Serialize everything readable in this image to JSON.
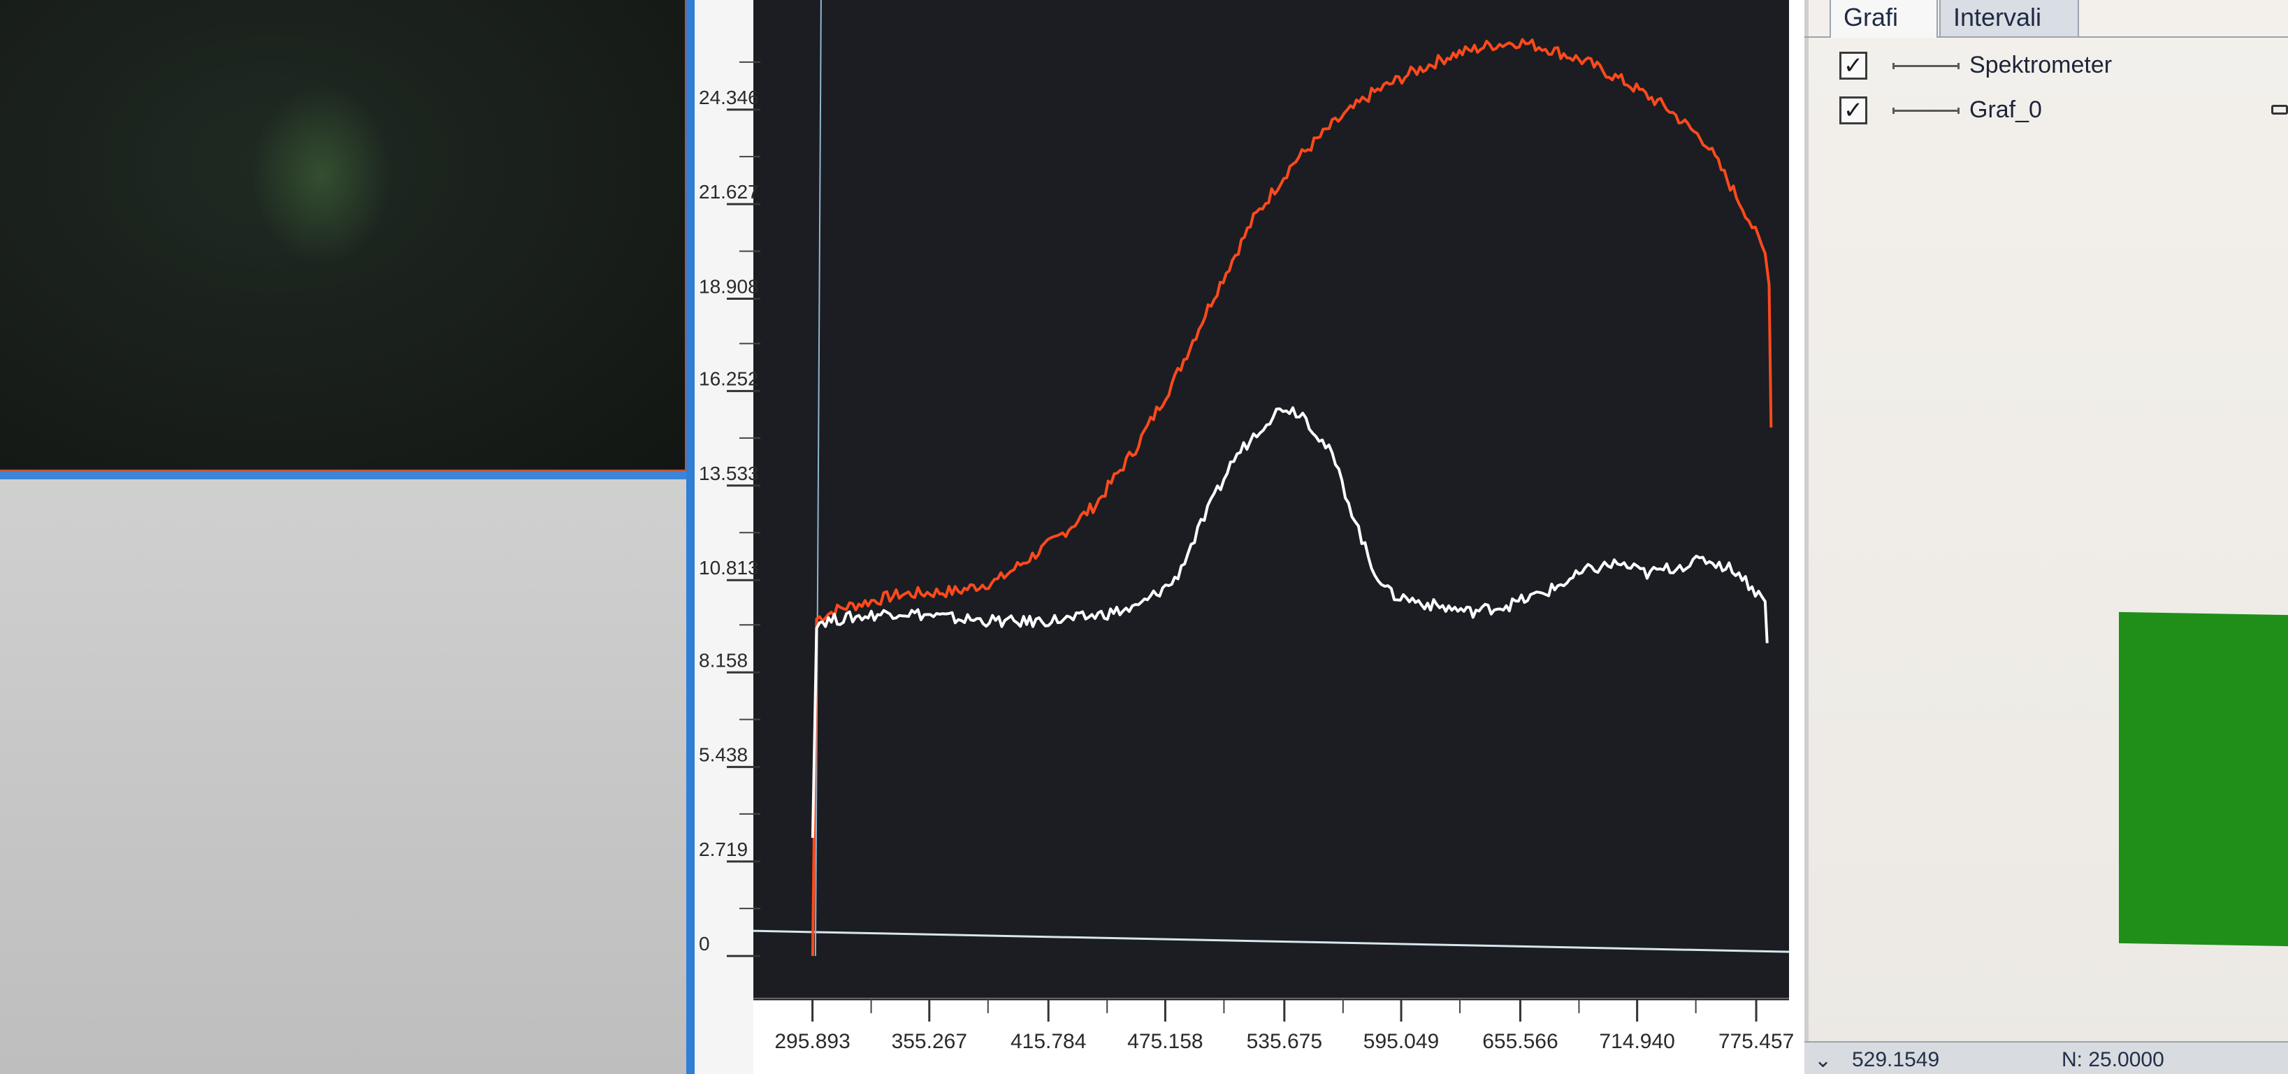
{
  "window": {
    "tabs": [
      {
        "label": "Grafi",
        "active": true
      },
      {
        "label": "Intervali",
        "active": false
      }
    ],
    "legend": [
      {
        "label": "Spektrometer",
        "checked": true,
        "color": "#ff4a1c"
      },
      {
        "label": "Graf_0",
        "checked": true,
        "color": "#ffffff"
      }
    ],
    "status": {
      "left": "529.1549",
      "right": "N: 25.0000"
    }
  },
  "colors": {
    "plot_background": "#1b1d22",
    "baseline": "#d8e6ee",
    "window_accent": "#2f7fd6",
    "swatch": "#1f8f1a"
  },
  "chart_data": {
    "type": "line",
    "title": "",
    "xlabel": "",
    "ylabel": "",
    "x_ticks": [
      "295.893",
      "355.267",
      "415.784",
      "475.158",
      "535.675",
      "595.049",
      "655.566",
      "714.940",
      "775.457"
    ],
    "y_ticks": [
      "0",
      "2.719",
      "5.438",
      "8.158",
      "10.813",
      "13.533",
      "16.252",
      "18.908",
      "21.627",
      "24.346"
    ],
    "xlim": [
      290,
      790
    ],
    "ylim": [
      -0.6,
      27.5
    ],
    "grid": false,
    "series": [
      {
        "name": "Spektrometer",
        "color": "#ff4a1c",
        "points": [
          [
            296,
            0
          ],
          [
            298,
            9.7
          ],
          [
            310,
            10.0
          ],
          [
            340,
            10.4
          ],
          [
            370,
            10.5
          ],
          [
            390,
            10.8
          ],
          [
            400,
            11.2
          ],
          [
            420,
            12.0
          ],
          [
            440,
            13.0
          ],
          [
            460,
            14.6
          ],
          [
            480,
            16.6
          ],
          [
            500,
            19.0
          ],
          [
            520,
            21.2
          ],
          [
            540,
            22.8
          ],
          [
            560,
            23.9
          ],
          [
            580,
            24.8
          ],
          [
            600,
            25.4
          ],
          [
            620,
            25.9
          ],
          [
            640,
            26.2
          ],
          [
            655,
            26.3
          ],
          [
            670,
            26.1
          ],
          [
            690,
            25.7
          ],
          [
            710,
            25.1
          ],
          [
            730,
            24.4
          ],
          [
            750,
            23.4
          ],
          [
            770,
            21.4
          ],
          [
            780,
            20.2
          ],
          [
            782,
            19.3
          ],
          [
            783,
            15.2
          ]
        ]
      },
      {
        "name": "Graf_0",
        "color": "#ffffff",
        "points": [
          [
            296,
            3.4
          ],
          [
            298,
            9.6
          ],
          [
            310,
            9.7
          ],
          [
            340,
            9.9
          ],
          [
            370,
            9.7
          ],
          [
            400,
            9.6
          ],
          [
            430,
            9.7
          ],
          [
            460,
            10.0
          ],
          [
            480,
            10.8
          ],
          [
            495,
            12.6
          ],
          [
            510,
            14.3
          ],
          [
            525,
            15.3
          ],
          [
            535,
            15.8
          ],
          [
            545,
            15.6
          ],
          [
            560,
            14.4
          ],
          [
            570,
            12.8
          ],
          [
            580,
            11.2
          ],
          [
            590,
            10.4
          ],
          [
            610,
            10.1
          ],
          [
            630,
            9.9
          ],
          [
            650,
            10.1
          ],
          [
            670,
            10.5
          ],
          [
            690,
            11.1
          ],
          [
            705,
            11.3
          ],
          [
            720,
            11.0
          ],
          [
            735,
            11.2
          ],
          [
            750,
            11.4
          ],
          [
            765,
            11.1
          ],
          [
            775,
            10.5
          ],
          [
            780,
            10.2
          ],
          [
            781,
            9.0
          ]
        ]
      }
    ]
  }
}
